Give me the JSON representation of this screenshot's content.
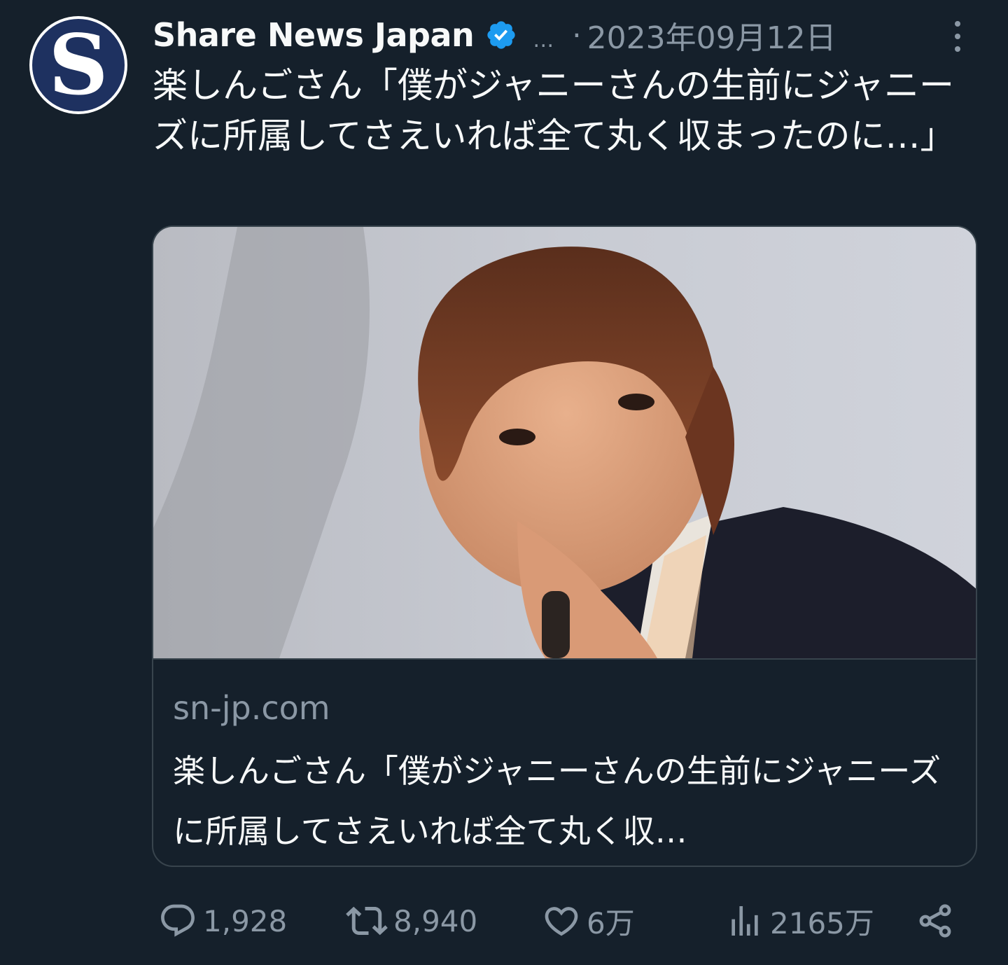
{
  "tweet": {
    "author_name": "Share News Japan",
    "avatar_letter": "S",
    "ellipsis": "…",
    "separator": "·",
    "date": "2023年09月12日",
    "text": "楽しんごさん「僕がジャニーさんの生前にジャニーズに所属してさえいれば全て丸く収まったのに…」"
  },
  "card": {
    "domain": "sn-jp.com",
    "title": "楽しんごさん「僕がジャニーさんの生前にジャニーズに所属してさえいれば全て丸く収…"
  },
  "actions": {
    "replies": "1,928",
    "retweets": "8,940",
    "likes": "6万",
    "views": "2165万"
  },
  "icons": {
    "verified": "verified-badge-icon",
    "more": "more-options-icon",
    "reply": "reply-icon",
    "retweet": "retweet-icon",
    "like": "heart-icon",
    "views": "views-icon",
    "share": "share-icon"
  },
  "colors": {
    "background": "#15202b",
    "text": "#f7f9f9",
    "muted": "#8b98a5",
    "verified": "#1d9bf0",
    "border": "#38444d"
  }
}
